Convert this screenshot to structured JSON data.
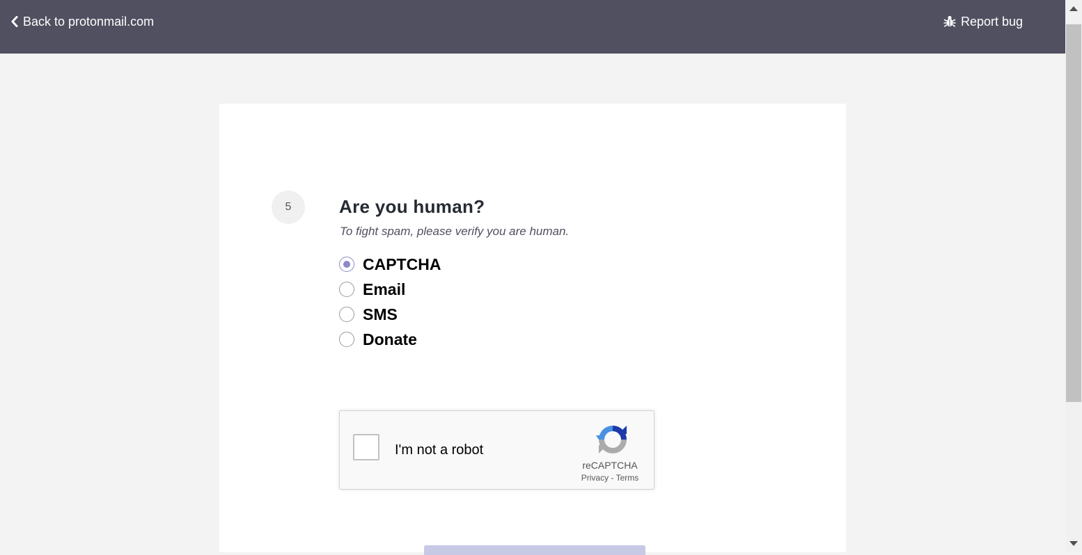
{
  "header": {
    "back_label": "Back to protonmail.com",
    "report_bug_label": "Report bug",
    "background_color": "#505061"
  },
  "step": {
    "number": "5",
    "title": "Are you human?",
    "subtitle": "To fight spam, please verify you are human."
  },
  "verification_options": [
    {
      "label": "CAPTCHA",
      "selected": true
    },
    {
      "label": "Email",
      "selected": false
    },
    {
      "label": "SMS",
      "selected": false
    },
    {
      "label": "Donate",
      "selected": false
    }
  ],
  "recaptcha": {
    "checkbox_label": "I'm not a robot",
    "brand": "reCAPTCHA",
    "privacy_label": "Privacy",
    "separator": "-",
    "terms_label": "Terms",
    "checked": false
  },
  "colors": {
    "accent": "#8b8bc8",
    "page_background": "#f3f3f3",
    "button_disabled": "#c8c9e5"
  },
  "icons": {
    "back": "chevron-left-icon",
    "report_bug": "bug-icon",
    "recaptcha": "recaptcha-logo-icon"
  }
}
